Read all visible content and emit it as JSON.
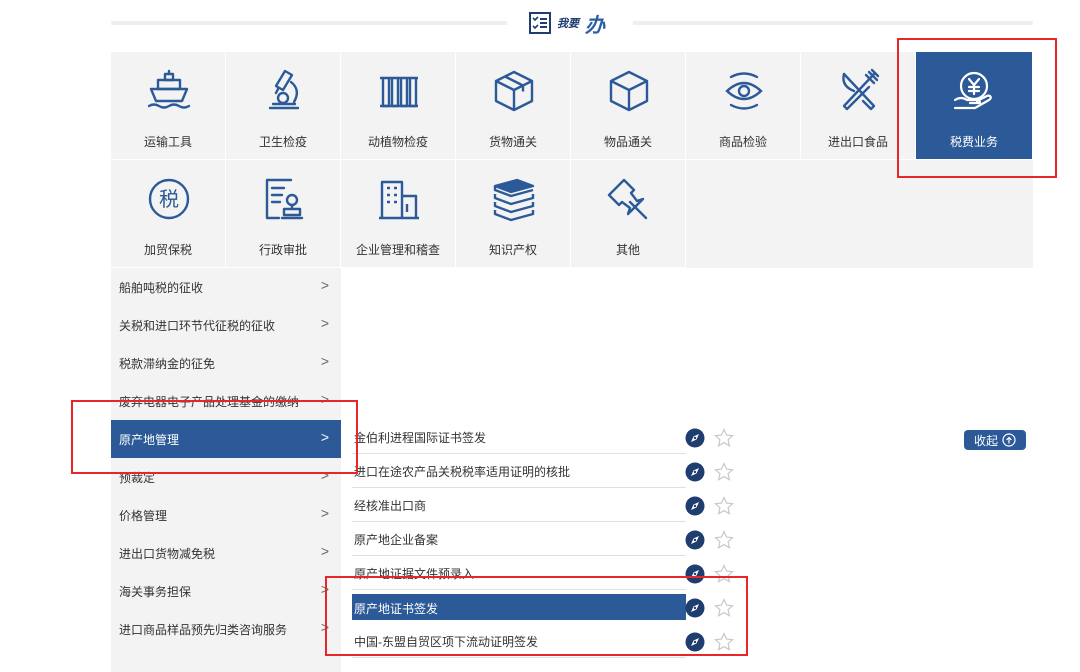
{
  "header": {
    "title_small": "我要",
    "title_big": "办"
  },
  "tiles": [
    {
      "label": "运输工具",
      "icon": "ship-icon"
    },
    {
      "label": "卫生检疫",
      "icon": "microscope-icon"
    },
    {
      "label": "动植物检疫",
      "icon": "plant-icon"
    },
    {
      "label": "货物通关",
      "icon": "package-icon"
    },
    {
      "label": "物品通关",
      "icon": "box-icon"
    },
    {
      "label": "商品检验",
      "icon": "eye-icon"
    },
    {
      "label": "进出口食品",
      "icon": "fork-knife-icon"
    },
    {
      "label": "税费业务",
      "icon": "yuan-hand-icon",
      "active": true
    },
    {
      "label": "加贸保税",
      "icon": "tax-icon"
    },
    {
      "label": "行政审批",
      "icon": "approval-icon"
    },
    {
      "label": "企业管理和稽查",
      "icon": "building-icon"
    },
    {
      "label": "知识产权",
      "icon": "books-icon"
    },
    {
      "label": "其他",
      "icon": "pin-icon"
    }
  ],
  "sidebar": {
    "items": [
      {
        "label": "船舶吨税的征收"
      },
      {
        "label": "关税和进口环节代征税的征收"
      },
      {
        "label": "税款滞纳金的征免"
      },
      {
        "label": "废弃电器电子产品处理基金的缴纳"
      },
      {
        "label": "原产地管理",
        "active": true
      },
      {
        "label": "预裁定"
      },
      {
        "label": "价格管理"
      },
      {
        "label": "进出口货物减免税"
      },
      {
        "label": "海关事务担保"
      },
      {
        "label": "进口商品样品预先归类咨询服务"
      }
    ],
    "arrow": ">"
  },
  "services": [
    {
      "label": "金伯利进程国际证书签发"
    },
    {
      "label": "进口在途农产品关税税率适用证明的核批"
    },
    {
      "label": "经核准出口商"
    },
    {
      "label": "原产地企业备案"
    },
    {
      "label": "原产地证据文件预录入"
    },
    {
      "label": "原产地证书签发",
      "active": true
    },
    {
      "label": "中国-东盟自贸区项下流动证明签发"
    }
  ],
  "collapse_label": "收起",
  "colors": {
    "accent": "#2c5a98",
    "highlight": "#e8262a",
    "tile_bg": "#f3f3f3"
  }
}
